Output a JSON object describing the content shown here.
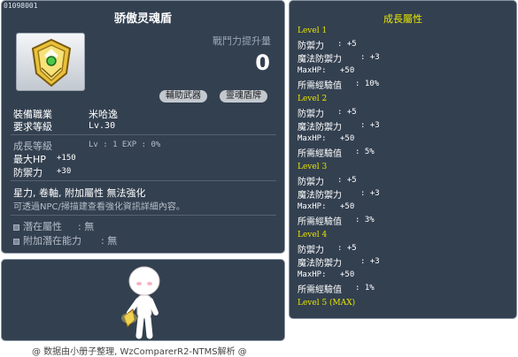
{
  "item": {
    "id": "01098001",
    "name": "骄傲灵魂盾",
    "power_label": "戰鬥力提升量",
    "power_value": "0",
    "tags": [
      "輔助武器",
      "靈魂盾牌"
    ],
    "job_label": "裝備職業",
    "job_value": "米哈逸",
    "req_level_label": "要求等級",
    "req_level_value": "Lv.30",
    "growth_label": "成長等級",
    "growth_value": "Lv : 1   EXP : 0%",
    "stats": [
      {
        "label": "最大HP",
        "value": "+150"
      },
      {
        "label": "防禦力",
        "value": "+30"
      }
    ],
    "attributes": "星力, 卷軸, 附加屬性 無法強化",
    "note": "可透過NPC/掃描建查看強化資訊詳細內容。",
    "potential_label": "潛在屬性",
    "potential_value": ": 無",
    "add_potential_label": "附加潛在能力",
    "add_potential_value": ": 無"
  },
  "growth_panel": {
    "title": "成長屬性",
    "levels": [
      {
        "title": "Level 1",
        "rows": [
          {
            "label": "防禦力",
            "value": ": +5"
          },
          {
            "label": "魔法防禦力",
            "value": ": +3"
          },
          {
            "label": "MaxHP:",
            "value": "+50"
          },
          {
            "label": "所需經驗值",
            "value": ": 10%"
          }
        ]
      },
      {
        "title": "Level 2",
        "rows": [
          {
            "label": "防禦力",
            "value": ": +5"
          },
          {
            "label": "魔法防禦力",
            "value": ": +3"
          },
          {
            "label": "MaxHP:",
            "value": "+50"
          },
          {
            "label": "所需經驗值",
            "value": ": 5%"
          }
        ]
      },
      {
        "title": "Level 3",
        "rows": [
          {
            "label": "防禦力",
            "value": ": +5"
          },
          {
            "label": "魔法防禦力",
            "value": ": +3"
          },
          {
            "label": "MaxHP:",
            "value": "+50"
          },
          {
            "label": "所需經驗值",
            "value": ": 3%"
          }
        ]
      },
      {
        "title": "Level 4",
        "rows": [
          {
            "label": "防禦力",
            "value": ": +5"
          },
          {
            "label": "魔法防禦力",
            "value": ": +3"
          },
          {
            "label": "MaxHP:",
            "value": "+50"
          },
          {
            "label": "所需經驗值",
            "value": ": 1%"
          }
        ]
      },
      {
        "title": "Level 5 (MAX)"
      }
    ]
  },
  "footer": "@ 数据由小册子整理, WzComparerR2-NTMS解析 @",
  "colors": {
    "panel_bg": "#334050",
    "panel_border": "#8a96a4",
    "level_title": "#e8e600",
    "tag_bg": "#c3c8cf"
  },
  "icons": [
    "soul-shield-item-icon",
    "bullet-icon",
    "character-avatar"
  ]
}
